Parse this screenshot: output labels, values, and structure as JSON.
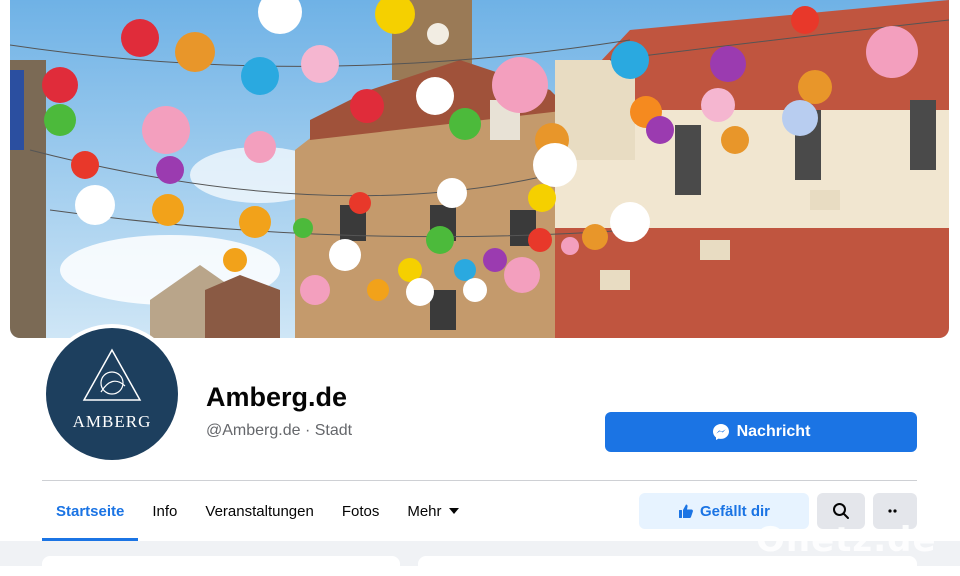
{
  "page": {
    "name": "Amberg.de",
    "handle_category": "@Amberg.de · Stadt",
    "avatar_text": "AMBERG"
  },
  "actions": {
    "message_label": "Nachricht",
    "like_label": "Gefällt dir"
  },
  "tabs": [
    {
      "label": "Startseite",
      "active": true
    },
    {
      "label": "Info",
      "active": false
    },
    {
      "label": "Veranstaltungen",
      "active": false
    },
    {
      "label": "Fotos",
      "active": false
    },
    {
      "label": "Mehr",
      "active": false
    }
  ],
  "watermark": "Onetz.de",
  "colors": {
    "accent": "#1b74e4",
    "avatar_bg": "#1d3f5e",
    "like_bg": "#e7f3ff"
  }
}
